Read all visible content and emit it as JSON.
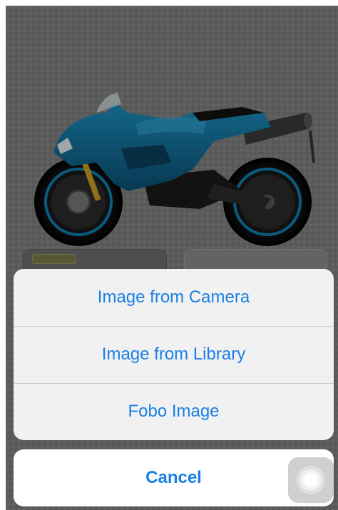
{
  "action_sheet": {
    "items": [
      {
        "label": "Image from Camera"
      },
      {
        "label": "Image from Library"
      },
      {
        "label": "Fobo Image"
      }
    ],
    "cancel_label": "Cancel"
  },
  "background": {
    "image": "motorcycle-icon"
  },
  "colors": {
    "accent": "#1a7fe4",
    "motorcycle_body": "#0f6f98",
    "sheet_bg": "#f6f6f6"
  }
}
